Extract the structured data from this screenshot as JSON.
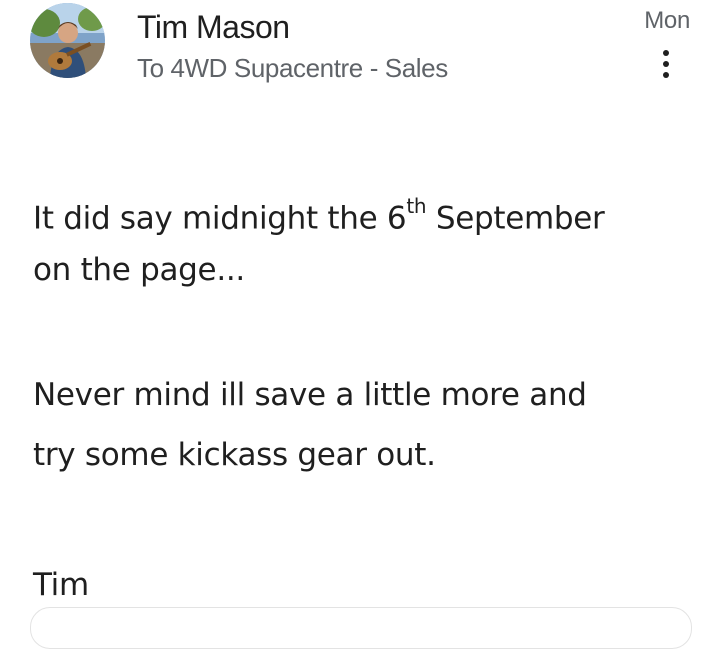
{
  "message": {
    "sender_name": "Tim Mason",
    "recipient_line": "To 4WD Supacentre - Sales",
    "date": "Mon",
    "more_icon": "more-vert-icon"
  },
  "body": {
    "paragraph1_line1_before": "It did say midnight the 6",
    "paragraph1_line1_sup": "th",
    "paragraph1_line1_after": " September",
    "paragraph1_line2": "on the page...",
    "paragraph2_line1": "Never mind ill save a little more and",
    "paragraph2_line2": "try some kickass gear out.",
    "signature": "Tim"
  },
  "colors": {
    "text_primary": "#1f1f1f",
    "text_secondary": "#5f6368"
  }
}
